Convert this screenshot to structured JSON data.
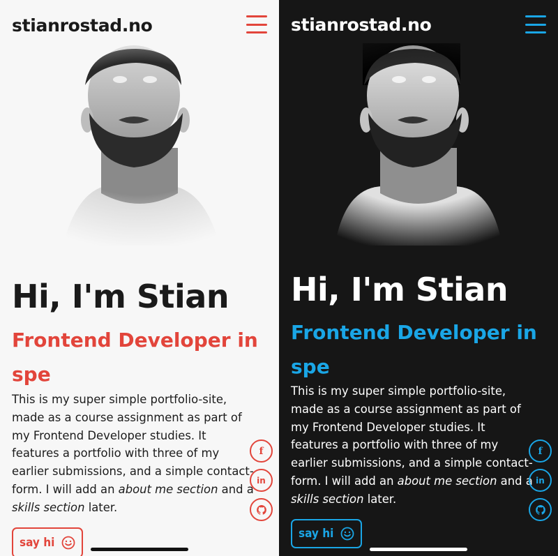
{
  "colors": {
    "light_accent": "#e2453b",
    "dark_accent": "#1aa6e6",
    "light_bg": "#f7f7f7",
    "dark_bg": "#161616"
  },
  "light": {
    "site_title": "stianrostad.no",
    "menu_icon": "hamburger-menu-icon",
    "hero_title": "Hi, I'm Stian",
    "subtitle": "Frontend Developer in spe",
    "intro_part1": "This is my super simple portfolio-site, made as a course assignment as part of my Frontend Developer studies. It features a portfolio with three of my earlier submissions, and a simple contact-form. I will add an ",
    "intro_em1": "about me section",
    "intro_part2": " and a ",
    "intro_em2": "skills section",
    "intro_part3": " later.",
    "social": [
      {
        "icon": "facebook-icon",
        "glyph": "f"
      },
      {
        "icon": "linkedin-icon",
        "glyph": "in"
      },
      {
        "icon": "github-icon",
        "glyph": "gh"
      }
    ],
    "say_hi_label": "say hi"
  },
  "dark": {
    "site_title": "stianrostad.no",
    "menu_icon": "hamburger-menu-icon",
    "hero_title": "Hi, I'm Stian",
    "subtitle": "Frontend Developer in spe",
    "intro_part1": "This is my super simple portfolio-site, made as a course assignment as part of my Frontend Developer studies. It features a portfolio with three of my earlier submissions, and a simple contact-form. I will add an ",
    "intro_em1": "about me section",
    "intro_part2": " and a ",
    "intro_em2": "skills section",
    "intro_part3": " later.",
    "social": [
      {
        "icon": "facebook-icon",
        "glyph": "f"
      },
      {
        "icon": "linkedin-icon",
        "glyph": "in"
      },
      {
        "icon": "github-icon",
        "glyph": "gh"
      }
    ],
    "say_hi_label": "say hi"
  }
}
